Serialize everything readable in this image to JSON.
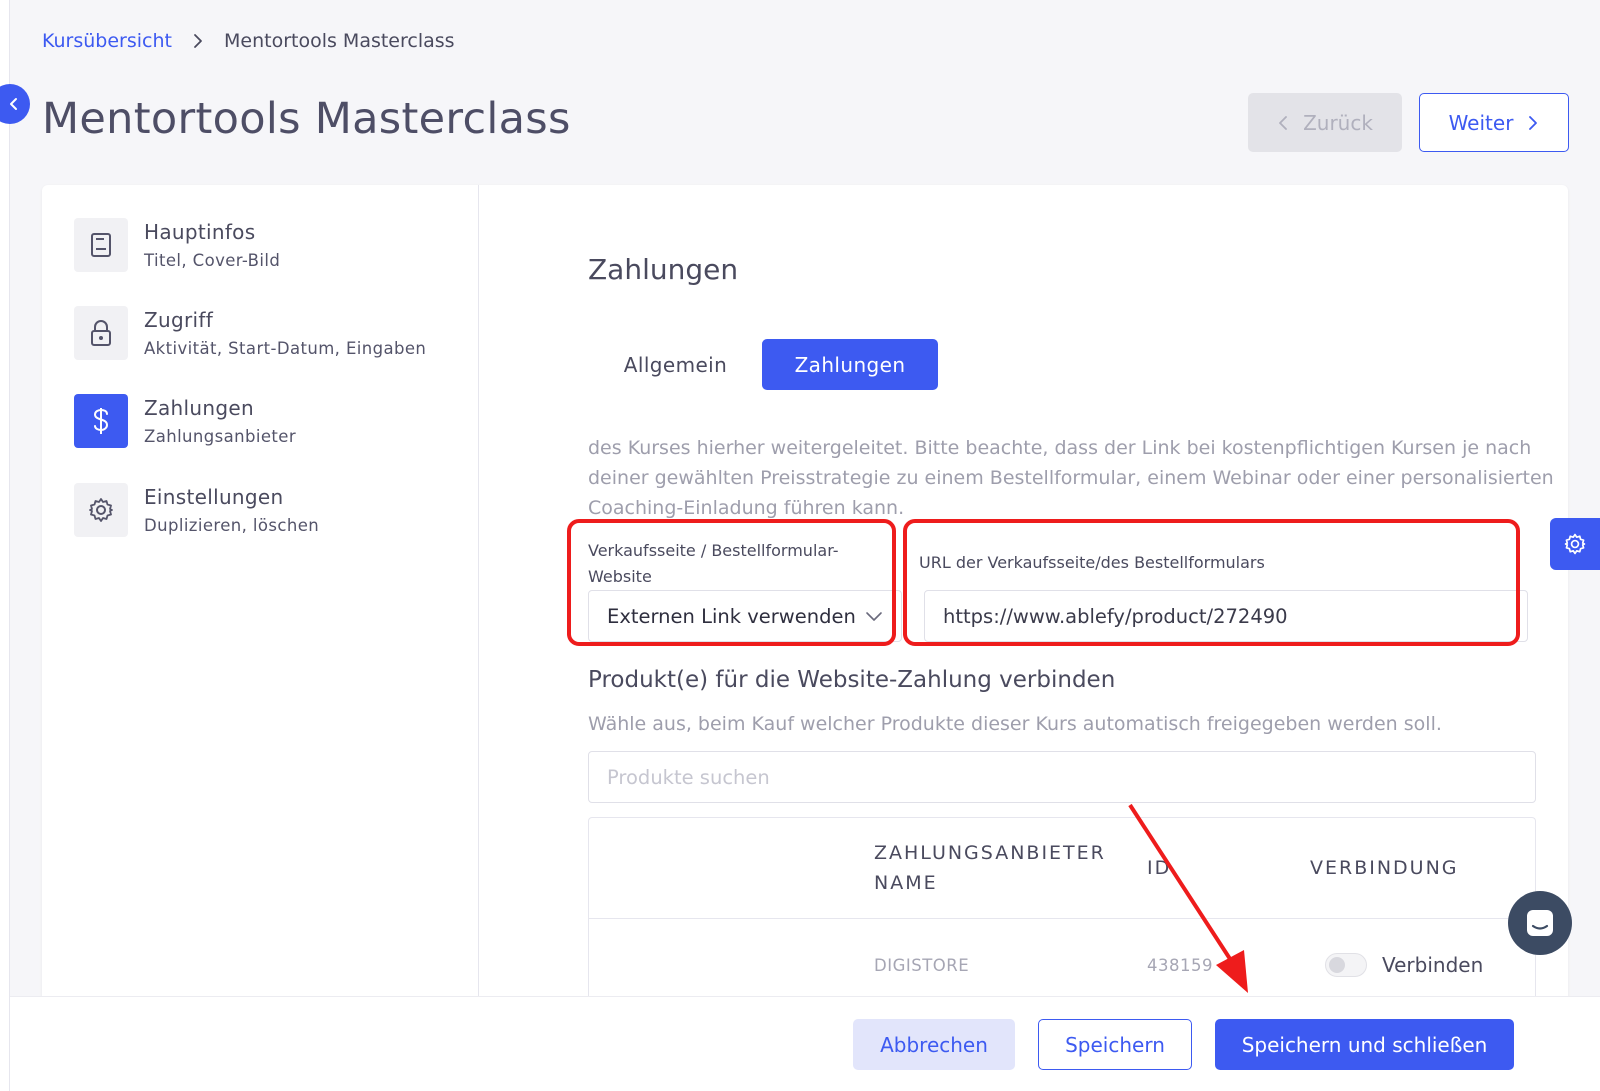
{
  "breadcrumb": {
    "parent": "Kursübersicht",
    "current": "Mentortools Masterclass"
  },
  "page": {
    "title": "Mentortools Masterclass"
  },
  "header_actions": {
    "back_label": "Zurück",
    "next_label": "Weiter"
  },
  "sidebar": {
    "items": [
      {
        "title": "Hauptinfos",
        "subtitle": "Titel, Cover-Bild",
        "icon": "book-icon",
        "active": false
      },
      {
        "title": "Zugriff",
        "subtitle": "Aktivität, Start-Datum, Eingaben",
        "icon": "lock-icon",
        "active": false
      },
      {
        "title": "Zahlungen",
        "subtitle": "Zahlungsanbieter",
        "icon": "dollar-icon",
        "active": true
      },
      {
        "title": "Einstellungen",
        "subtitle": "Duplizieren, löschen",
        "icon": "gear-icon",
        "active": false
      }
    ]
  },
  "main": {
    "section_title": "Zahlungen",
    "tabs": [
      {
        "label": "Allgemein",
        "active": false
      },
      {
        "label": "Zahlungen",
        "active": true
      }
    ],
    "description": "des Kurses hierher weitergeleitet. Bitte beachte, dass der Link bei kostenpflichtigen Kursen je nach deiner gewählten Preisstrategie zu einem Bestellformular, einem Webinar oder einer personalisierten Coaching-Einladung führen kann.",
    "sales_page": {
      "label": "Verkaufsseite / Bestellformular-Website",
      "selected": "Externen Link verwenden"
    },
    "url_field": {
      "label": "URL der Verkaufsseite/des Bestellformulars",
      "value": "https://www.ablefy/product/272490"
    },
    "products": {
      "title": "Produkt(e) für die Website-Zahlung verbinden",
      "description": "Wähle aus, beim Kauf welcher Produkte dieser Kurs automatisch freigegeben werden soll.",
      "search_placeholder": "Produkte suchen"
    },
    "table": {
      "headers": {
        "provider": "ZAHLUNGSANBIETER NAME",
        "id": "ID",
        "connection": "VERBINDUNG"
      },
      "rows": [
        {
          "provider": "DIGISTORE",
          "id": "438159",
          "connection_label": "Verbinden",
          "connected": false
        }
      ]
    }
  },
  "footer": {
    "cancel_label": "Abbrechen",
    "save_label": "Speichern",
    "save_close_label": "Speichern und schließen"
  },
  "colors": {
    "accent": "#3d5af1",
    "annotation": "#ee1c1c",
    "chat_fab": "#3c4b63"
  }
}
